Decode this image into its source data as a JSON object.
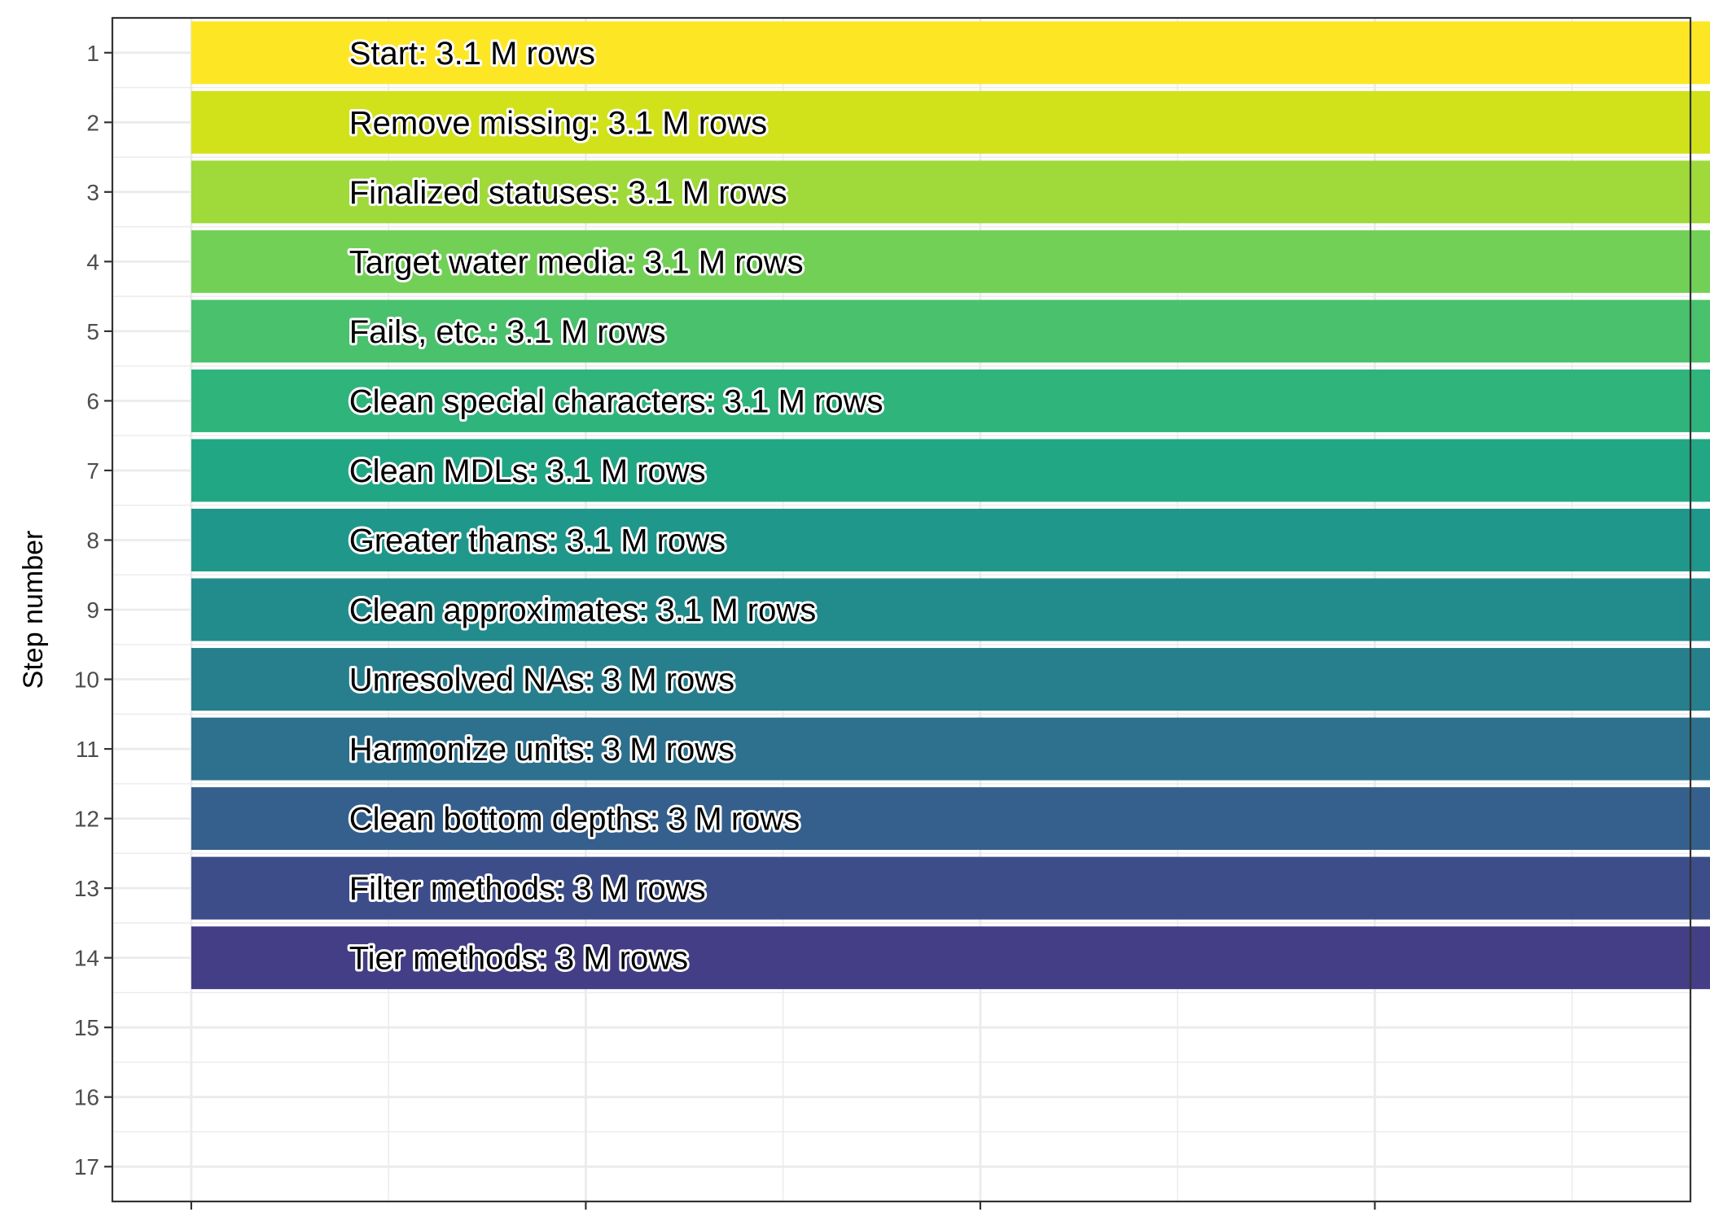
{
  "chart_data": {
    "type": "bar",
    "orientation": "horizontal",
    "title": "",
    "xlabel": "",
    "ylabel": "Step number",
    "ylim": [
      0.5,
      17.5
    ],
    "xlim": [
      -0.2,
      3.8
    ],
    "x_ticks": [
      0,
      1,
      2,
      3,
      4
    ],
    "x_tick_labels": [
      "",
      "",
      "",
      "",
      ""
    ],
    "y_ticks": [
      1,
      2,
      3,
      4,
      5,
      6,
      7,
      8,
      9,
      10,
      11,
      12,
      13,
      14,
      15,
      16,
      17
    ],
    "y_tick_labels": [
      "1",
      "2",
      "3",
      "4",
      "5",
      "6",
      "7",
      "8",
      "9",
      "10",
      "11",
      "12",
      "13",
      "14",
      "15",
      "16",
      "17"
    ],
    "grid": true,
    "legend": "none",
    "categories": [
      1,
      2,
      3,
      4,
      5,
      6,
      7,
      8,
      9,
      10,
      11,
      12,
      13,
      14
    ],
    "values": [
      3.96,
      3.96,
      3.95,
      3.95,
      3.94,
      3.94,
      3.94,
      3.94,
      3.94,
      3.87,
      3.87,
      3.87,
      3.86,
      3.86
    ],
    "labels": [
      "Start:  3.1 M rows",
      "Remove missing:  3.1 M rows",
      "Finalized statuses:  3.1 M rows",
      "Target water media:  3.1 M rows",
      "Fails, etc.:  3.1 M rows",
      "Clean special characters:  3.1 M rows",
      "Clean MDLs:  3.1 M rows",
      "Greater thans:  3.1 M rows",
      "Clean approximates:  3.1 M rows",
      "Unresolved NAs:  3 M rows",
      "Harmonize units:  3 M rows",
      "Clean bottom depths:  3 M rows",
      "Filter methods:  3 M rows",
      "Tier methods:  3 M rows"
    ],
    "colors": [
      "#FDE725",
      "#D1E21B",
      "#9FDA3A",
      "#73D056",
      "#4AC16D",
      "#2FB47C",
      "#22A785",
      "#1F988B",
      "#228C8D",
      "#277F8E",
      "#2D718E",
      "#35608D",
      "#3D4D8A",
      "#433E85"
    ]
  }
}
